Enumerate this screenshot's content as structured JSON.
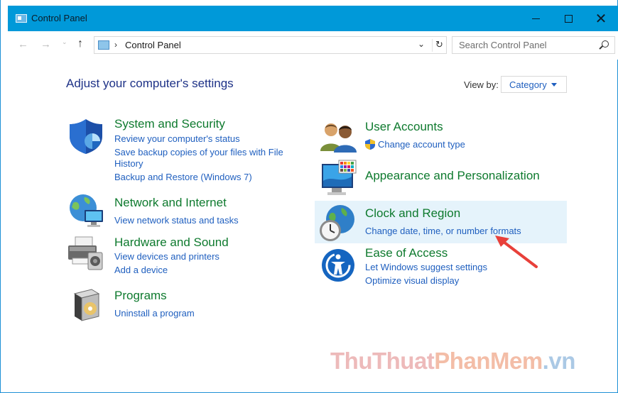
{
  "window": {
    "title": "Control Panel",
    "minimize_label": "",
    "maximize_label": "",
    "close_label": "✕"
  },
  "nav": {
    "back": "←",
    "forward": "→",
    "recent": "⌄",
    "up": "↑",
    "breadcrumb_sep": "›",
    "address": "Control Panel",
    "dropdown": "⌄",
    "refresh": "↻"
  },
  "search": {
    "placeholder": "Search Control Panel"
  },
  "main": {
    "heading": "Adjust your computer's settings",
    "view_by_label": "View by:",
    "view_by_value": "Category"
  },
  "categories_left": [
    {
      "title": "System and Security",
      "links": [
        "Review your computer's status",
        "Save backup copies of your files with File",
        "History",
        "Backup and Restore (Windows 7)"
      ]
    },
    {
      "title": "Network and Internet",
      "links": [
        "View network status and tasks"
      ]
    },
    {
      "title": "Hardware and Sound",
      "links": [
        "View devices and printers",
        "Add a device"
      ]
    },
    {
      "title": "Programs",
      "links": [
        "Uninstall a program"
      ]
    }
  ],
  "categories_right": [
    {
      "title": "User Accounts",
      "links": [
        "Change account type"
      ]
    },
    {
      "title": "Appearance and Personalization",
      "links": []
    },
    {
      "title": "Clock and Region",
      "links": [
        "Change date, time, or number formats"
      ]
    },
    {
      "title": "Ease of Access",
      "links": [
        "Let Windows suggest settings",
        "Optimize visual display"
      ]
    }
  ],
  "watermark": {
    "part1": "ThuThuat",
    "part2": "PhanMem",
    "part3": ".vn"
  },
  "colors": {
    "titlebar": "#0099d9",
    "category_title": "#0e7a2e",
    "link": "#1f5fbf",
    "heading": "#1e3287",
    "highlight": "#e5f3fb",
    "annotation_arrow": "#e8403a"
  }
}
